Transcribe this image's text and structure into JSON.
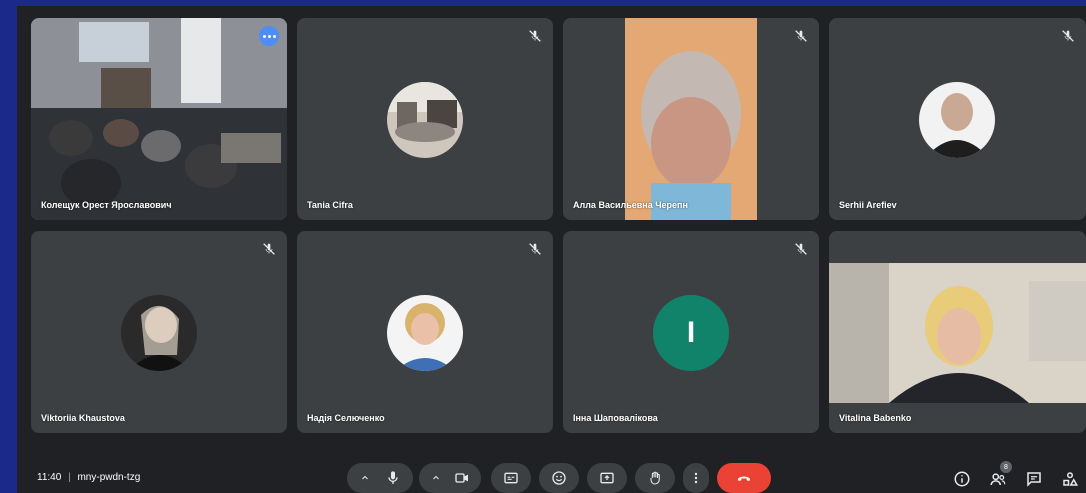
{
  "participants": [
    {
      "name": "Колещук Орест Ярославович"
    },
    {
      "name": "Tania Cifra"
    },
    {
      "name": "Алла Васильевна Черепн"
    },
    {
      "name": "Serhii Arefiev"
    },
    {
      "name": "Viktoriia Khaustova"
    },
    {
      "name": "Надія Селюченко"
    },
    {
      "name": "Інна Шаповалікова",
      "initial": "I"
    },
    {
      "name": "Vitalina Babenko"
    }
  ],
  "meeting": {
    "time": "11:40",
    "separator": "|",
    "code": "mny-pwdn-tzg"
  },
  "people_count": "8",
  "colors": {
    "accent": "#8ab4f8",
    "end_call": "#ea4335",
    "tile_bg": "#3c4043",
    "avatar_letter_bg": "#12836b"
  },
  "icons": [
    "mic-off-icon",
    "more-options-icon",
    "chevron-up-icon",
    "mic-icon",
    "camera-icon",
    "captions-icon",
    "emoji-icon",
    "present-icon",
    "raise-hand-icon",
    "more-vert-icon",
    "end-call-icon",
    "info-icon",
    "people-icon",
    "chat-icon",
    "activities-icon"
  ]
}
